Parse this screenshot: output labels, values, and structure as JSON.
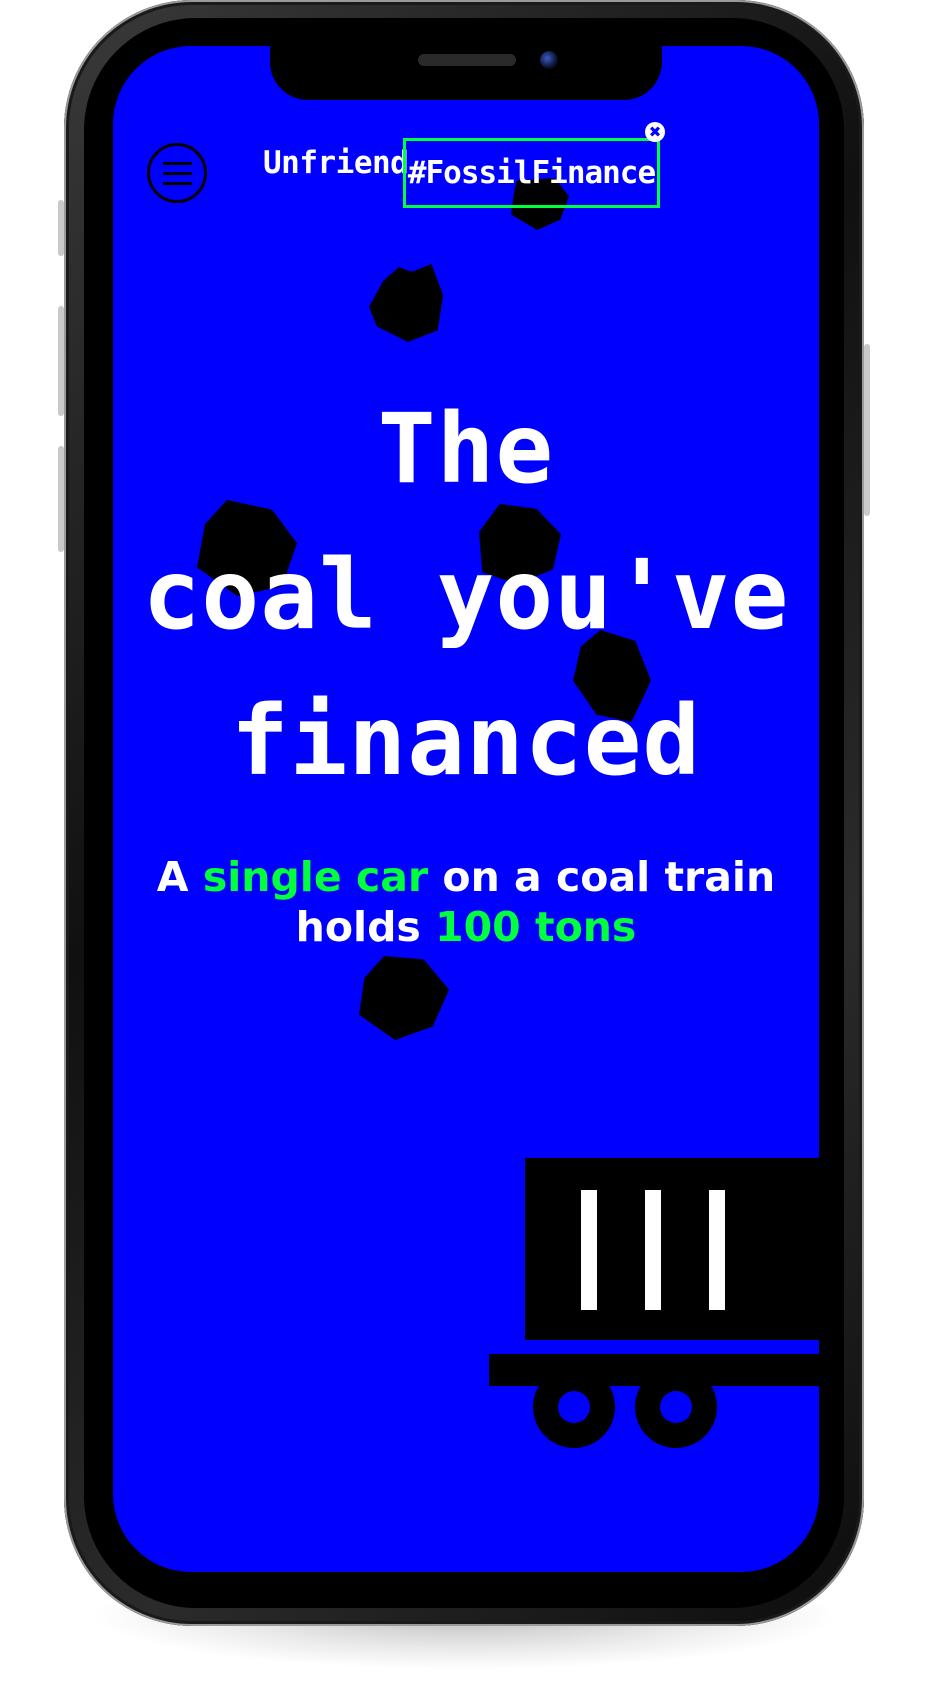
{
  "header": {
    "menu_icon": "hamburger-menu-icon",
    "brand_prefix": "Unfriend",
    "brand_hashtag": "#FossilFinance",
    "close_icon_glyph": "✖"
  },
  "hero": {
    "headline_line1": "The",
    "headline_line2": "coal you've",
    "headline_line3": "financed",
    "subheadline": {
      "part1": "A ",
      "highlight1": "single car",
      "part2": " on a coal train holds ",
      "highlight2": "100 tons"
    }
  },
  "colors": {
    "background": "#0000ff",
    "text": "#ffffff",
    "accent": "#00ff3c",
    "coal": "#000000"
  },
  "illustration": {
    "train_car_icon": "coal-train-car-icon",
    "coal_icon": "coal-lump-icon"
  }
}
